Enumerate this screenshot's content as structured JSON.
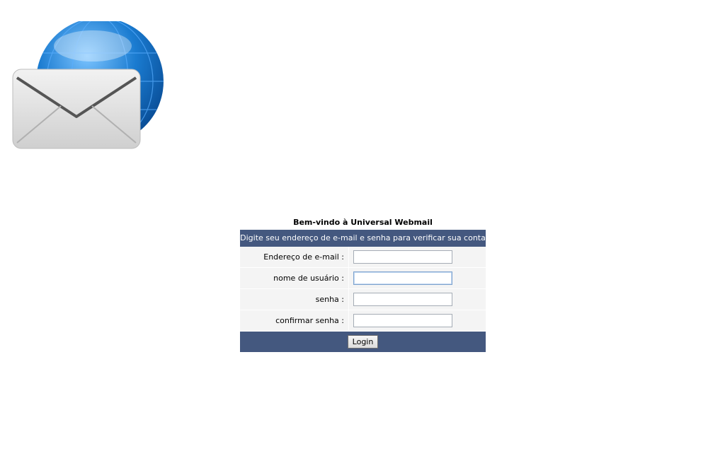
{
  "logo": {
    "icon": "webmail-envelope-globe-icon",
    "colors": {
      "globe": "#1a7bd0",
      "envelope": "#e6e6e6"
    }
  },
  "welcome_title": "Bem-vindo à Universal Webmail",
  "form": {
    "header": "Digite seu endereço de e-mail e senha para verificar sua conta",
    "fields": [
      {
        "label": "Endereço de e-mail :",
        "value": "",
        "placeholder": ""
      },
      {
        "label": "nome de usuário :",
        "value": "",
        "placeholder": ""
      },
      {
        "label": "senha :",
        "value": "",
        "placeholder": ""
      },
      {
        "label": "confirmar senha :",
        "value": "",
        "placeholder": ""
      }
    ],
    "submit_label": "Login"
  },
  "colors": {
    "bar": "#44587f",
    "row_bg": "#f4f4f4"
  }
}
